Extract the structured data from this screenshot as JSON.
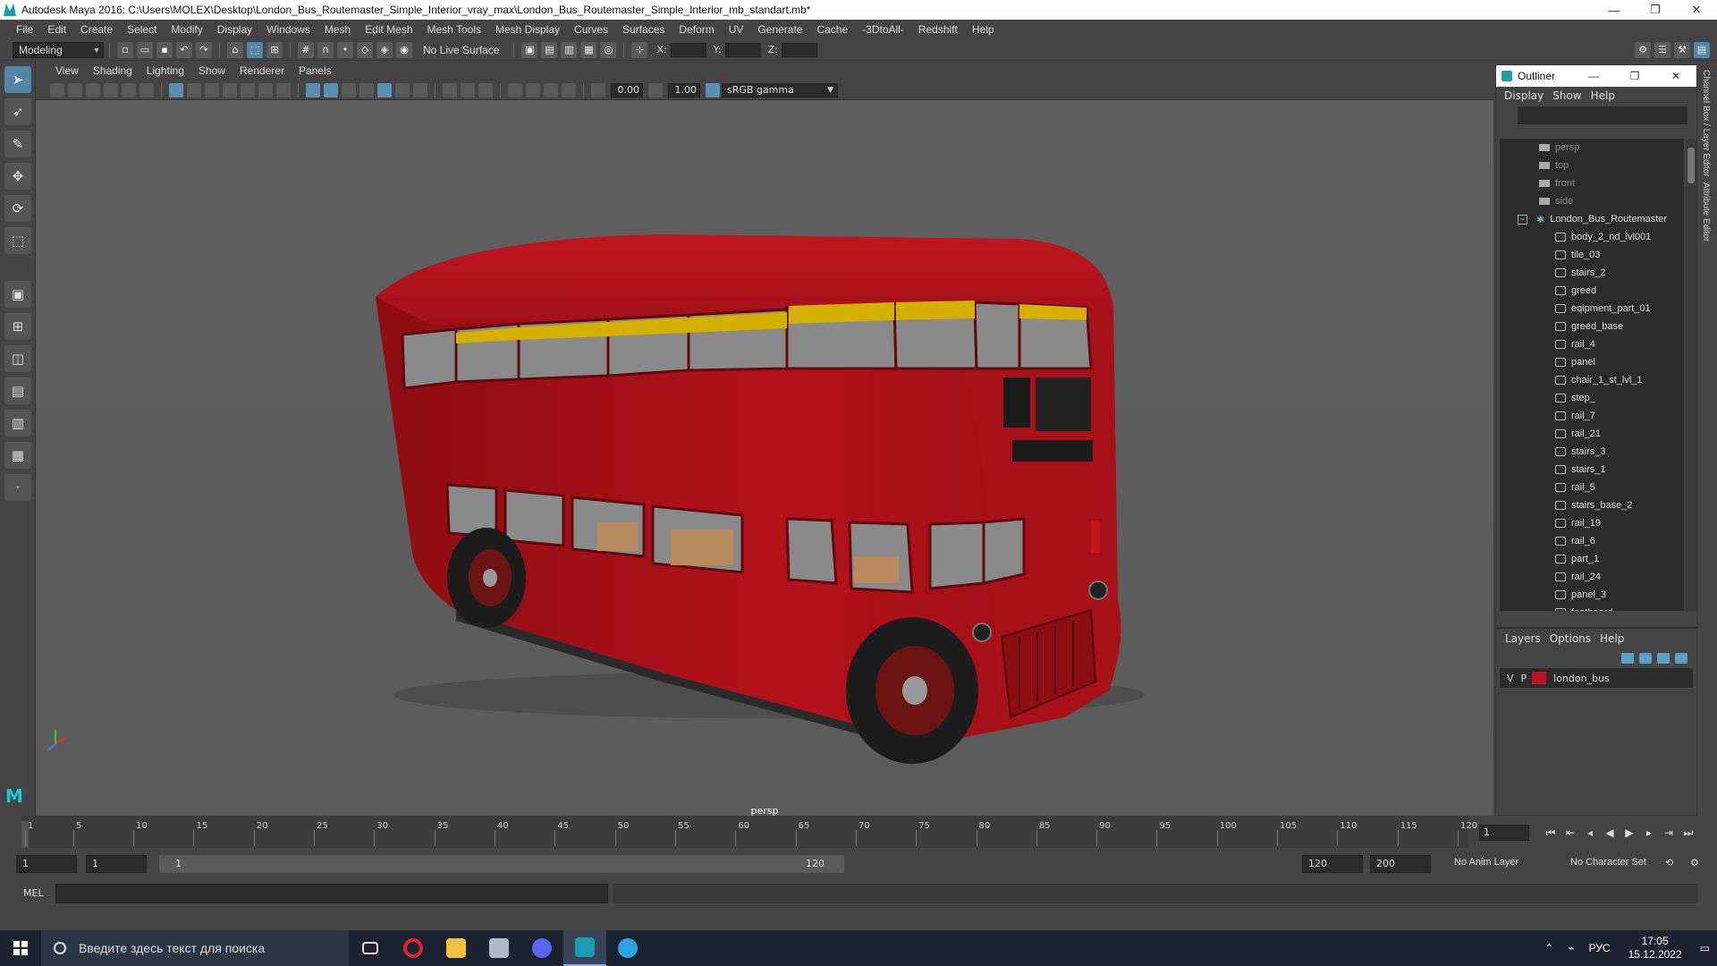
{
  "window": {
    "title": "Autodesk Maya 2016: C:\\Users\\MOLEX\\Desktop\\London_Bus_Routemaster_Simple_Interior_vray_max\\London_Bus_Routemaster_Simple_Interior_mb_standart.mb*",
    "minimize": "—",
    "restore": "❐",
    "close": "✕"
  },
  "menu": [
    "File",
    "Edit",
    "Create",
    "Select",
    "Modify",
    "Display",
    "Windows",
    "Mesh",
    "Edit Mesh",
    "Mesh Tools",
    "Mesh Display",
    "Curves",
    "Surfaces",
    "Deform",
    "UV",
    "Generate",
    "Cache",
    "-3DtoAll-",
    "Redshift",
    "Help"
  ],
  "statusline": {
    "mode": "Modeling",
    "live_surface": "No Live Surface",
    "x_label": "X:",
    "y_label": "Y:",
    "z_label": "Z:"
  },
  "panel_menu": [
    "View",
    "Shading",
    "Lighting",
    "Show",
    "Renderer",
    "Panels"
  ],
  "panel_tools": {
    "exposure": "0.00",
    "gamma": "1.00",
    "color_space": "sRGB gamma"
  },
  "viewport": {
    "camera": "persp"
  },
  "outliner": {
    "title": "Outliner",
    "menu": [
      "Display",
      "Show",
      "Help"
    ],
    "cameras": [
      "persp",
      "top",
      "front",
      "side"
    ],
    "group": "London_Bus_Routemaster",
    "children": [
      "body_2_nd_lvl001",
      "tile_03",
      "stairs_2",
      "greed",
      "eqipment_part_01",
      "greed_base",
      "rail_4",
      "panel",
      "chair_1_st_lvl_1",
      "step_",
      "rail_7",
      "rail_21",
      "stairs_3",
      "stairs_1",
      "rail_5",
      "stairs_base_2",
      "rail_19",
      "rail_6",
      "part_1",
      "rail_24",
      "panel_3",
      "footboard"
    ]
  },
  "sidetabs": [
    "Channel Box / Layer Editor",
    "Attribute Editor"
  ],
  "layers": {
    "menu": [
      "Layers",
      "Options",
      "Help"
    ],
    "row": {
      "v": "V",
      "p": "P",
      "name": "london_bus",
      "color": "#c0102a"
    }
  },
  "timeline": {
    "ticks": [
      1,
      5,
      10,
      15,
      20,
      25,
      30,
      35,
      40,
      45,
      50,
      55,
      60,
      65,
      70,
      75,
      80,
      85,
      90,
      95,
      100,
      105,
      110,
      115,
      120
    ],
    "current_frame": "1"
  },
  "range": {
    "start": "1",
    "playback_start": "1",
    "slider_start": "1",
    "slider_end": "120",
    "playback_end": "120",
    "end": "200",
    "anim_layer": "No Anim Layer",
    "character_set": "No Character Set"
  },
  "mel": {
    "label": "MEL"
  },
  "taskbar": {
    "search_placeholder": "Введите здесь текст для поиска",
    "lang": "РУС",
    "time": "17:05",
    "date": "15.12.2022"
  },
  "colors": {
    "bus_red": "#b0111a",
    "viewport_bg": "#5d5d5d",
    "accent": "#5285a6"
  }
}
